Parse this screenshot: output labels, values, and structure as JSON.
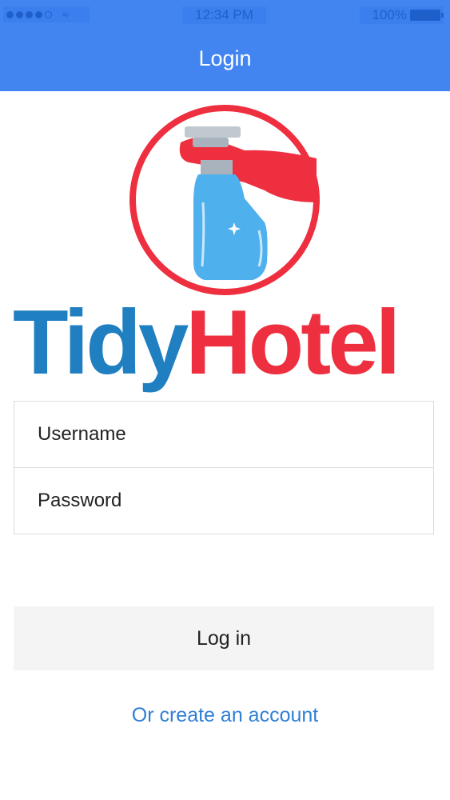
{
  "status_bar": {
    "time": "12:34 PM",
    "battery": "100%"
  },
  "nav": {
    "title": "Login"
  },
  "brand": {
    "part1": "Tidy",
    "part2": "Hotel",
    "colors": {
      "tidy": "#1f7fc0",
      "hotel": "#ee2f3f",
      "accent_header": "#4285f0"
    }
  },
  "form": {
    "username_placeholder": "Username",
    "password_placeholder": "Password"
  },
  "actions": {
    "login_label": "Log in",
    "create_account_label": "Or create an account"
  },
  "icons": [
    "signal-icon",
    "wifi-icon",
    "battery-icon",
    "spray-bottle-logo-icon"
  ]
}
